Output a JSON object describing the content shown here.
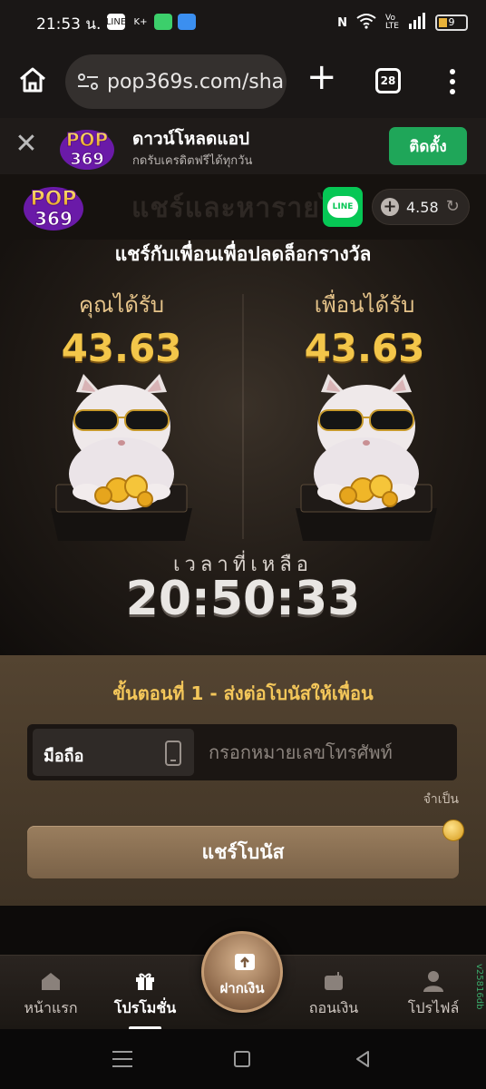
{
  "status_bar": {
    "time": "21:53 น.",
    "battery": "9",
    "notif_labels": [
      "LINE",
      "K+"
    ]
  },
  "browser": {
    "url": "pop369s.com/sha",
    "tab_count": "28"
  },
  "banner": {
    "title": "ดาวน์โหลดแอป",
    "subtitle": "กดรับเครดิตฟรีได้ทุกวัน",
    "install_label": "ติดตั้ง",
    "logo_text": "POP 369"
  },
  "header": {
    "ghost_title": "แชร์และหารายได้",
    "line_label": "LINE",
    "balance": "4.58",
    "logo_text": "POP 369"
  },
  "hero": {
    "title": "แชร์กับเพื่อนเพื่อปลดล็อกรางวัล",
    "you_get_label": "คุณได้รับ",
    "you_get_value": "43.63",
    "friend_get_label": "เพื่อนได้รับ",
    "friend_get_value": "43.63",
    "time_left_label": "เวลาที่เหลือ",
    "time_left_value": "20:50:33"
  },
  "step": {
    "title": "ขั้นตอนที่ 1 - ส่งต่อโบนัสให้เพื่อน",
    "phone_type_label": "มือถือ",
    "phone_placeholder": "กรอกหมายเลขโทรศัพท์",
    "required_label": "จำเป็น",
    "share_button": "แชร์โบนัส"
  },
  "bottom_nav": {
    "home": "หน้าแรก",
    "promotions": "โปรโมชั่น",
    "deposit": "ฝากเงิน",
    "withdraw": "ถอนเงิน",
    "profile": "โปรไฟล์",
    "version": "v25816db"
  },
  "colors": {
    "accent_gold": "#f3c64a",
    "install_green": "#1fa659",
    "line_green": "#06c755"
  }
}
